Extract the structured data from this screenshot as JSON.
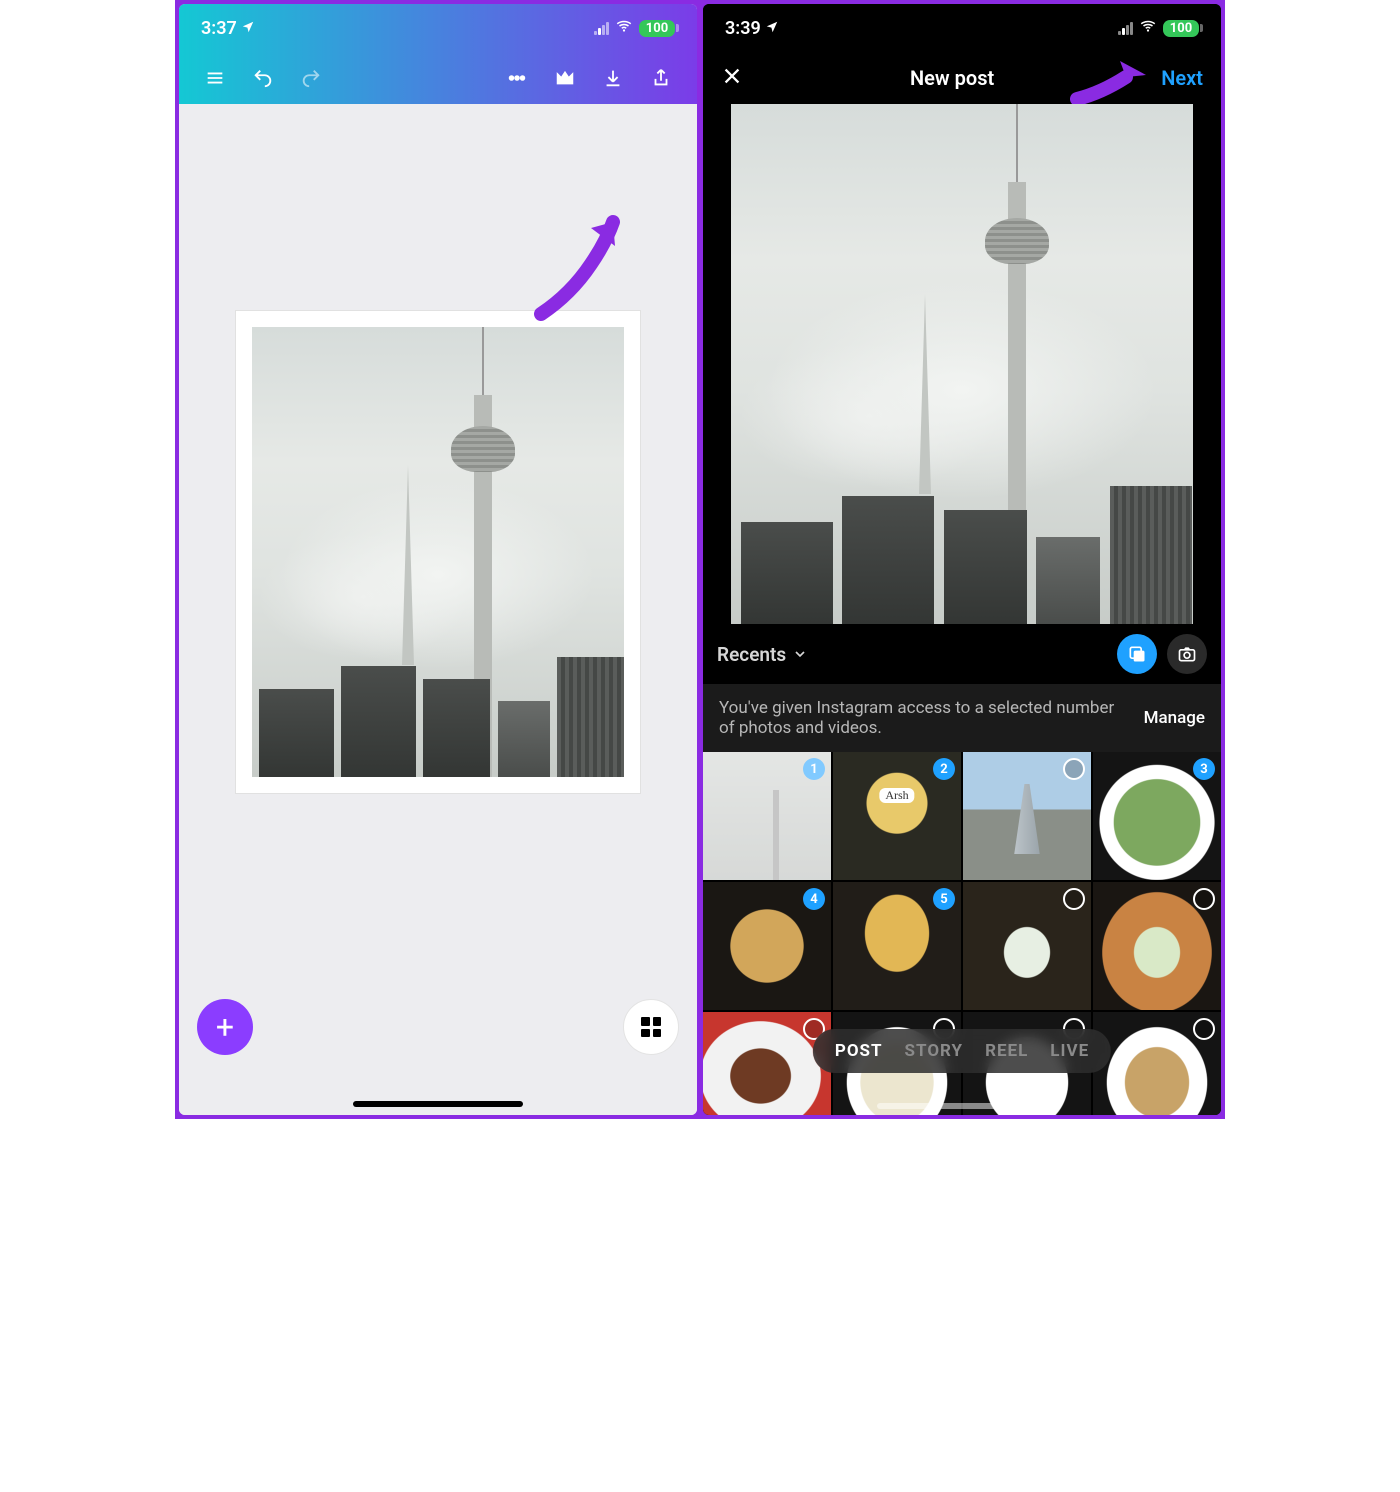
{
  "colors": {
    "purple_accent": "#8b3dff",
    "blue_accent": "#1fa1ff",
    "battery_green": "#34c759",
    "annotation_purple": "#8a2be2"
  },
  "left": {
    "status": {
      "time": "3:37",
      "battery_pct": "100"
    },
    "fab_plus_label": "+"
  },
  "right": {
    "status": {
      "time": "3:39",
      "battery_pct": "100"
    },
    "header": {
      "title": "New post",
      "next_label": "Next"
    },
    "album": {
      "name": "Recents"
    },
    "notice": {
      "text": "You've given Instagram access to a selected number of photos and videos.",
      "manage_label": "Manage"
    },
    "gallery": [
      {
        "kind": "tower-mini",
        "badge_num": "1",
        "selected": true
      },
      {
        "kind": "starbucks",
        "badge_num": "2"
      },
      {
        "kind": "skyline",
        "badge_ring": true
      },
      {
        "kind": "food-green",
        "badge_num": "3"
      },
      {
        "kind": "bread",
        "badge_num": "4"
      },
      {
        "kind": "fries",
        "badge_num": "5"
      },
      {
        "kind": "drink1",
        "badge_ring": true
      },
      {
        "kind": "drink2",
        "badge_ring": true
      },
      {
        "kind": "eclair",
        "badge_ring": true
      },
      {
        "kind": "pasta2",
        "badge_ring": true
      },
      {
        "kind": "plate3",
        "badge_ring": true
      },
      {
        "kind": "dish4",
        "badge_ring": true
      }
    ],
    "modes": [
      {
        "label": "POST",
        "active": true
      },
      {
        "label": "STORY",
        "active": false
      },
      {
        "label": "REEL",
        "active": false
      },
      {
        "label": "LIVE",
        "active": false
      }
    ]
  }
}
